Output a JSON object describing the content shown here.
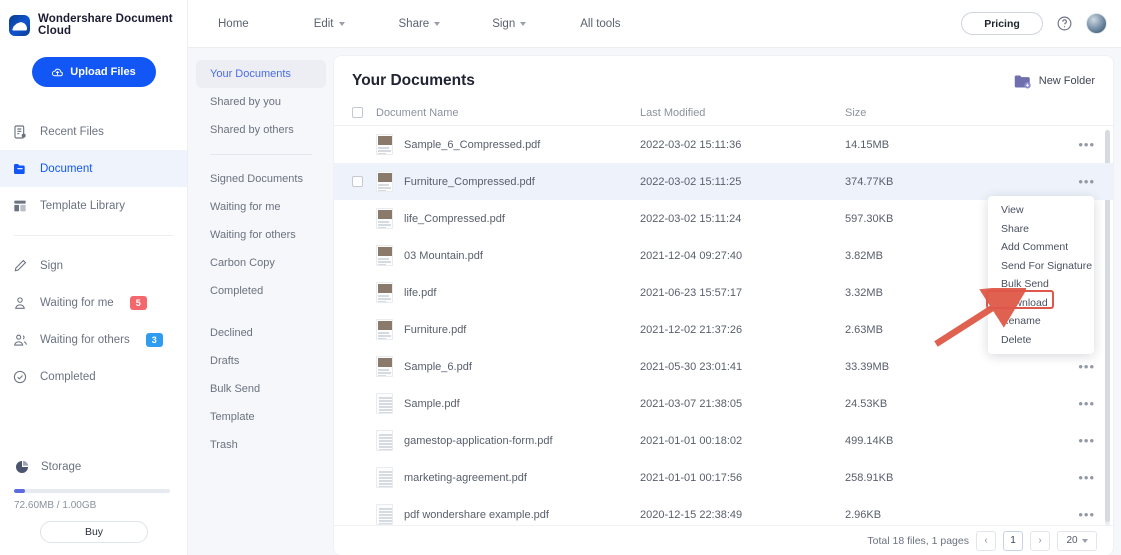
{
  "brand": {
    "name": "Wondershare Document Cloud",
    "logo_icon": "cloud-logo-icon"
  },
  "upload": {
    "label": "Upload Files",
    "icon": "cloud-upload-icon",
    "color": "#1257f5"
  },
  "sidebar": {
    "items": [
      {
        "label": "Recent Files",
        "icon": "recent-files-icon",
        "active": false
      },
      {
        "label": "Document",
        "icon": "folder-icon",
        "active": true
      },
      {
        "label": "Template Library",
        "icon": "template-library-icon",
        "active": false
      },
      {
        "label": "Sign",
        "icon": "pen-icon",
        "active": false
      },
      {
        "label": "Waiting for me",
        "icon": "person-icon",
        "active": false,
        "badge": "5",
        "badge_color": "#f4676d"
      },
      {
        "label": "Waiting for others",
        "icon": "people-icon",
        "active": false,
        "badge": "3",
        "badge_color": "#309cf0"
      },
      {
        "label": "Completed",
        "icon": "check-circle-icon",
        "active": false
      }
    ],
    "storage": {
      "label": "Storage",
      "icon": "pie-chart-icon",
      "usage_text": "72.60MB / 1.00GB",
      "percent": 7,
      "buy_label": "Buy"
    }
  },
  "topbar": {
    "menu": [
      {
        "label": "Home",
        "caret": false
      },
      {
        "label": "Edit",
        "caret": true
      },
      {
        "label": "Share",
        "caret": true
      },
      {
        "label": "Sign",
        "caret": true
      },
      {
        "label": "All tools",
        "caret": false
      }
    ],
    "pricing_label": "Pricing",
    "help_icon": "help-circle-icon",
    "avatar_icon": "user-avatar"
  },
  "subnav": {
    "group1": [
      {
        "label": "Your Documents",
        "active": true
      },
      {
        "label": "Shared by you",
        "active": false
      },
      {
        "label": "Shared by others",
        "active": false
      }
    ],
    "group2": [
      {
        "label": "Signed Documents",
        "active": false
      },
      {
        "label": "Waiting for me",
        "active": false
      },
      {
        "label": "Waiting for others",
        "active": false
      },
      {
        "label": "Carbon Copy",
        "active": false
      },
      {
        "label": "Completed",
        "active": false
      }
    ],
    "group3": [
      {
        "label": "Declined",
        "active": false
      },
      {
        "label": "Drafts",
        "active": false
      },
      {
        "label": "Bulk Send",
        "active": false
      },
      {
        "label": "Template",
        "active": false
      },
      {
        "label": "Trash",
        "active": false
      }
    ]
  },
  "main": {
    "title": "Your Documents",
    "new_folder_label": "New Folder",
    "new_folder_icon": "new-folder-icon",
    "columns": {
      "name": "Document Name",
      "modified": "Last Modified",
      "size": "Size"
    },
    "rows": [
      {
        "name": "Sample_6_Compressed.pdf",
        "modified": "2022-03-02 15:11:36",
        "size": "14.15MB",
        "thumb": "photo",
        "selected": false
      },
      {
        "name": "Furniture_Compressed.pdf",
        "modified": "2022-03-02 15:11:25",
        "size": "374.77KB",
        "thumb": "photo",
        "selected": true
      },
      {
        "name": "life_Compressed.pdf",
        "modified": "2022-03-02 15:11:24",
        "size": "597.30KB",
        "thumb": "photo",
        "selected": false
      },
      {
        "name": "03 Mountain.pdf",
        "modified": "2021-12-04 09:27:40",
        "size": "3.82MB",
        "thumb": "photo",
        "selected": false
      },
      {
        "name": "life.pdf",
        "modified": "2021-06-23 15:57:17",
        "size": "3.32MB",
        "thumb": "photo",
        "selected": false
      },
      {
        "name": "Furniture.pdf",
        "modified": "2021-12-02 21:37:26",
        "size": "2.63MB",
        "thumb": "photo",
        "selected": false
      },
      {
        "name": "Sample_6.pdf",
        "modified": "2021-05-30 23:01:41",
        "size": "33.39MB",
        "thumb": "photo",
        "selected": false
      },
      {
        "name": "Sample.pdf",
        "modified": "2021-03-07 21:38:05",
        "size": "24.53KB",
        "thumb": "text",
        "selected": false
      },
      {
        "name": "gamestop-application-form.pdf",
        "modified": "2021-01-01 00:18:02",
        "size": "499.14KB",
        "thumb": "text",
        "selected": false
      },
      {
        "name": "marketing-agreement.pdf",
        "modified": "2021-01-01 00:17:56",
        "size": "258.91KB",
        "thumb": "text",
        "selected": false
      },
      {
        "name": "pdf wondershare example.pdf",
        "modified": "2020-12-15 22:38:49",
        "size": "2.96KB",
        "thumb": "text",
        "selected": false
      }
    ],
    "row_menu_icon": "more-options-icon"
  },
  "context_menu": {
    "items": [
      {
        "label": "View",
        "highlighted": false
      },
      {
        "label": "Share",
        "highlighted": false
      },
      {
        "label": "Add Comment",
        "highlighted": false
      },
      {
        "label": "Send For Signature",
        "highlighted": false
      },
      {
        "label": "Bulk Send",
        "highlighted": false
      },
      {
        "label": "Download",
        "highlighted": true
      },
      {
        "label": "Rename",
        "highlighted": false
      },
      {
        "label": "Delete",
        "highlighted": false
      }
    ],
    "highlight_color": "#e0564a"
  },
  "annotation": {
    "arrow_color": "#e0614f",
    "points_to": "Download"
  },
  "pagination": {
    "total_text": "Total 18 files, 1 pages",
    "prev": "‹",
    "current": "1",
    "next": "›",
    "page_size": "20"
  }
}
